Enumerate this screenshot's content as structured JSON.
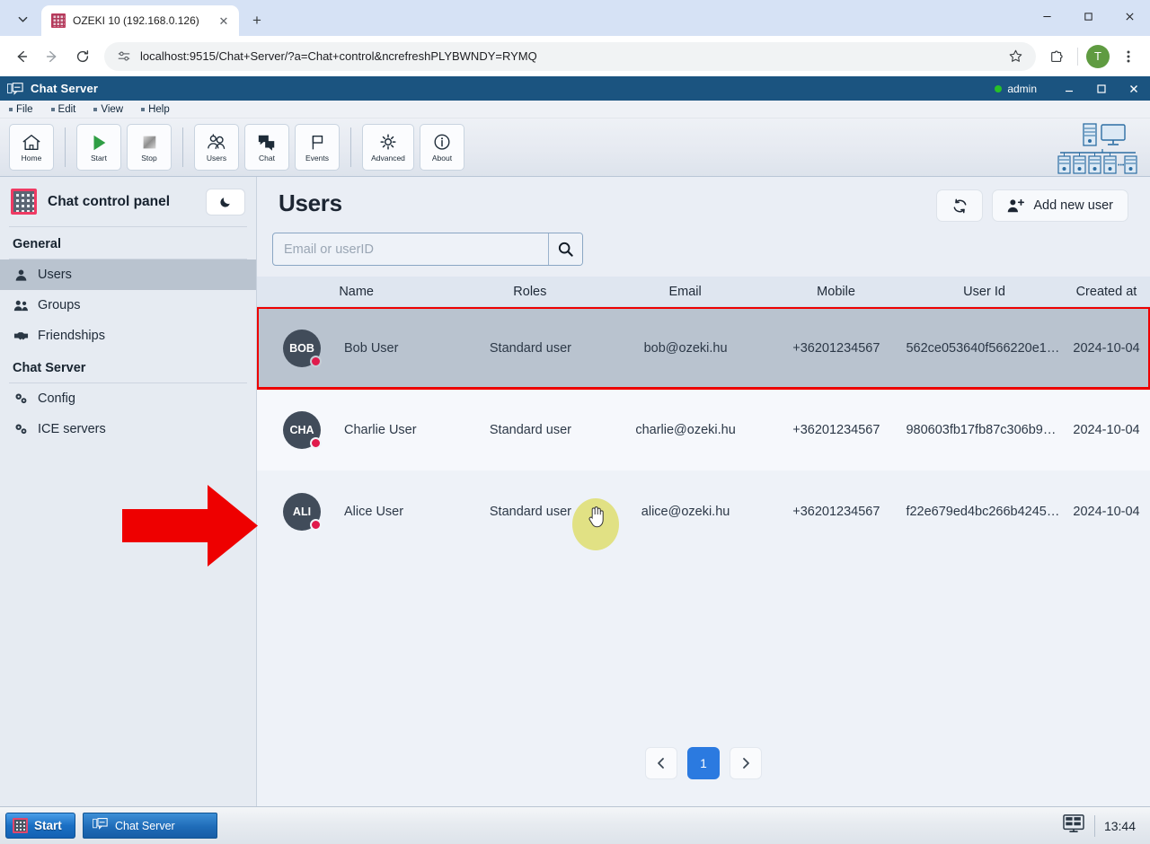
{
  "browser": {
    "tab": {
      "title": "OZEKI 10 (192.168.0.126)",
      "favicon": "ozeki-grid-icon",
      "close_label": "✕"
    },
    "tab_search_icon": "chevron-down-icon",
    "new_tab_label": "+",
    "window_controls": {
      "minimize": "—",
      "maximize": "☐",
      "close": "✕"
    },
    "nav": {
      "back": "←",
      "forward": "→",
      "reload": "⟳"
    },
    "omnibox": {
      "site_info_icon": "tune-icon",
      "url": "localhost:9515/Chat+Server/?a=Chat+control&ncrefreshPLYBWNDY=RYMQ",
      "bookmark_icon": "star-icon"
    },
    "extensions_icon": "puzzle-icon",
    "profile_initial": "T",
    "menu_icon": "three-dots-icon"
  },
  "app": {
    "title": "Chat Server",
    "title_icon": "chat-server-icon",
    "account": "admin",
    "status_color": "#28c028",
    "window_controls": {
      "minimize": "_",
      "maximize": "☐",
      "close": "✕"
    },
    "menubar": [
      "File",
      "Edit",
      "View",
      "Help"
    ],
    "ribbon": [
      {
        "label": "Home",
        "icon": "home-icon"
      },
      {
        "label": "Start",
        "icon": "play-icon"
      },
      {
        "label": "Stop",
        "icon": "stop-icon"
      },
      {
        "label": "Users",
        "icon": "users-icon"
      },
      {
        "label": "Chat",
        "icon": "chat-bubbles-icon"
      },
      {
        "label": "Events",
        "icon": "flag-icon"
      },
      {
        "label": "Advanced",
        "icon": "gear-icon"
      },
      {
        "label": "About",
        "icon": "info-icon"
      }
    ]
  },
  "sidebar": {
    "logo_icon": "ozeki-grid-icon",
    "title": "Chat control panel",
    "theme_toggle_icon": "moon-icon",
    "groups": [
      {
        "label": "General",
        "items": [
          {
            "label": "Users",
            "icon": "person-icon",
            "active": true
          },
          {
            "label": "Groups",
            "icon": "people-icon",
            "active": false
          },
          {
            "label": "Friendships",
            "icon": "handshake-icon",
            "active": false
          }
        ]
      },
      {
        "label": "Chat Server",
        "items": [
          {
            "label": "Config",
            "icon": "gears-icon",
            "active": false
          },
          {
            "label": "ICE servers",
            "icon": "gears-icon",
            "active": false
          }
        ]
      }
    ]
  },
  "main": {
    "title": "Users",
    "refresh_icon": "refresh-icon",
    "add_user_label": "Add new user",
    "add_user_icon": "person-plus-icon",
    "search": {
      "placeholder": "Email or userID",
      "value": "",
      "button_icon": "search-icon"
    },
    "table": {
      "columns": [
        "Name",
        "Roles",
        "Email",
        "Mobile",
        "User Id",
        "Created at"
      ],
      "rows": [
        {
          "initials": "BOB",
          "name": "Bob User",
          "role": "Standard user",
          "email": "bob@ozeki.hu",
          "mobile": "+36201234567",
          "user_id": "562ce053640f566220e19…",
          "created_at": "2024-10-04",
          "status": "offline"
        },
        {
          "initials": "CHA",
          "name": "Charlie User",
          "role": "Standard user",
          "email": "charlie@ozeki.hu",
          "mobile": "+36201234567",
          "user_id": "980603fb17fb87c306b99…",
          "created_at": "2024-10-04",
          "status": "offline"
        },
        {
          "initials": "ALI",
          "name": "Alice User",
          "role": "Standard user",
          "email": "alice@ozeki.hu",
          "mobile": "+36201234567",
          "user_id": "f22e679ed4bc266b42459…",
          "created_at": "2024-10-04",
          "status": "offline"
        }
      ]
    },
    "pagination": {
      "prev": "‹",
      "current": "1",
      "next": "›"
    }
  },
  "annotations": {
    "arrow_color": "#ee0000",
    "highlight_color": "#ee0000",
    "cursor_halo_color": "#dfe07a"
  },
  "taskbar": {
    "start_label": "Start",
    "start_icon": "ozeki-grid-icon",
    "task_label": "Chat Server",
    "task_icon": "chat-server-icon",
    "tray_icon": "display-icon",
    "clock": "13:44"
  }
}
